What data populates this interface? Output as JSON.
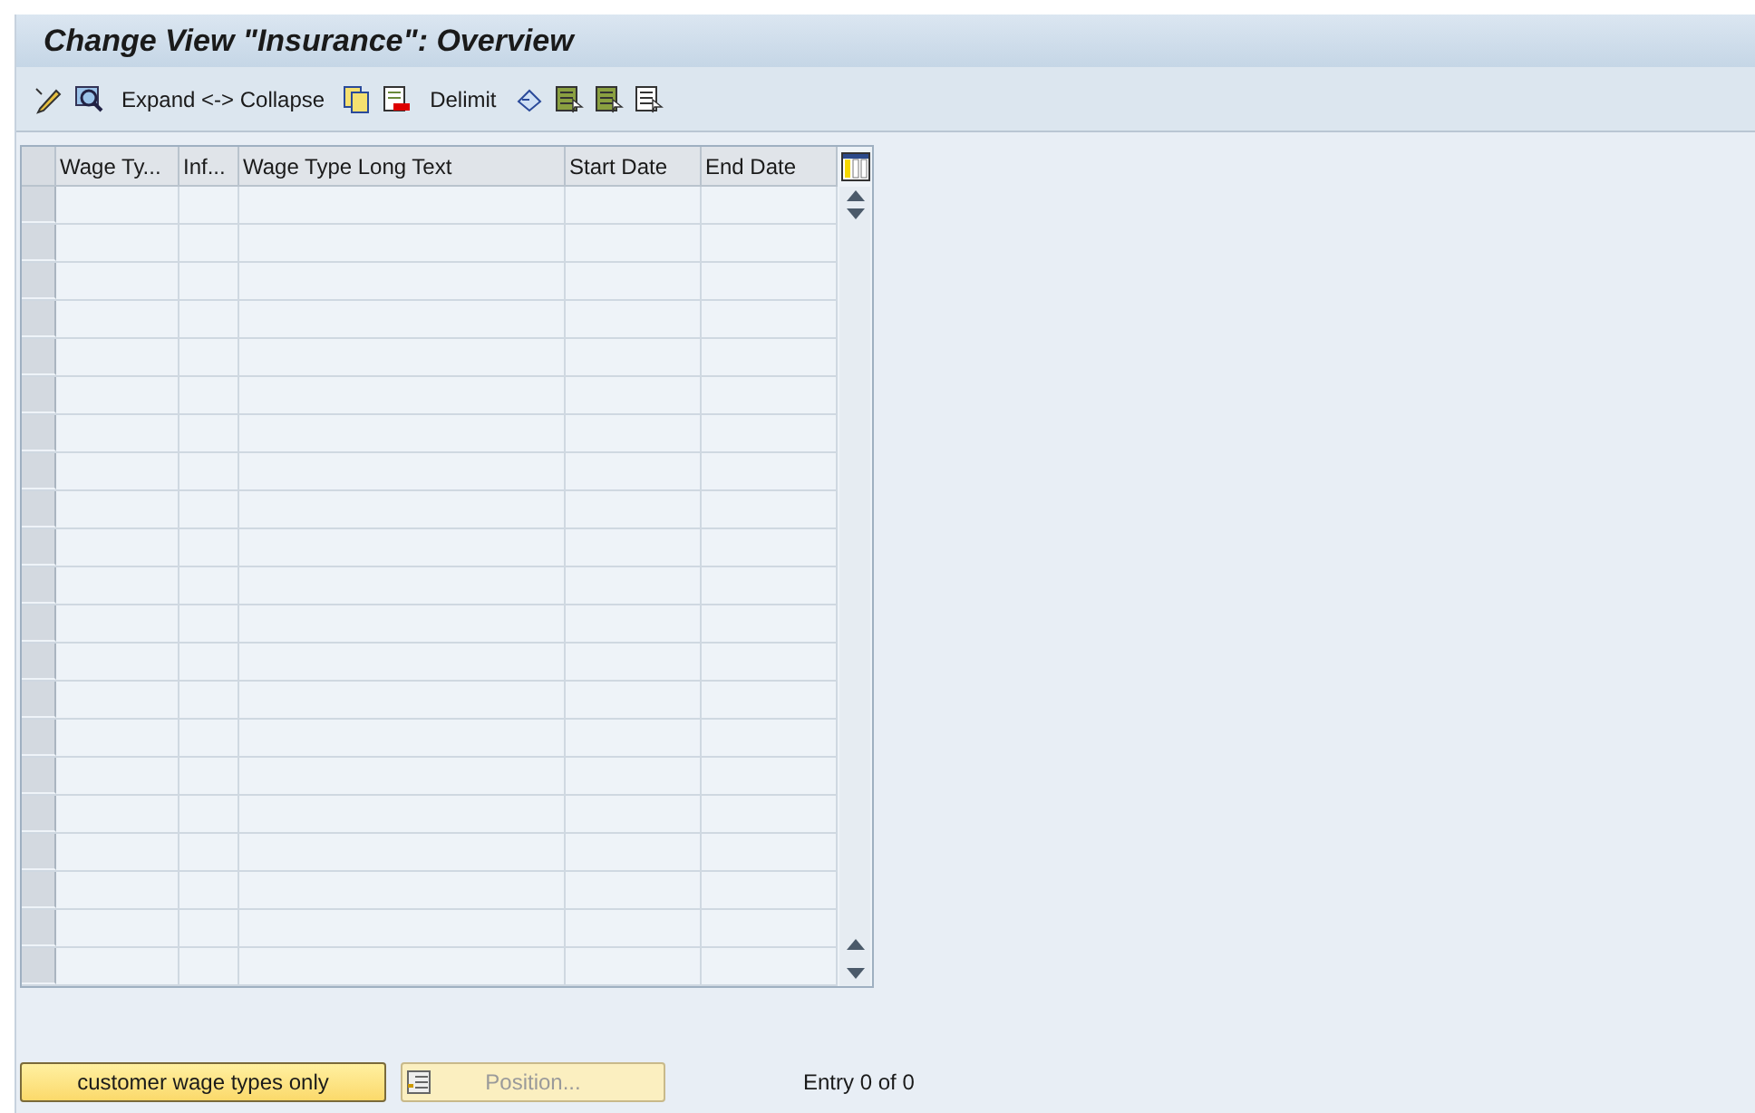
{
  "window": {
    "title": "Change View \"Insurance\": Overview"
  },
  "toolbar": {
    "buttons": [
      "Expand <-> Collapse",
      "Delimit"
    ]
  },
  "table": {
    "columns": [
      "Wage Ty...",
      "Inf...",
      "Wage Type Long Text",
      "Start Date",
      "End Date"
    ]
  },
  "footer": {
    "buttons": [
      {
        "label": "customer wage types only",
        "disabled": false
      },
      {
        "label": "Position...",
        "disabled": true
      }
    ],
    "entry": "Entry 0 of 0"
  }
}
